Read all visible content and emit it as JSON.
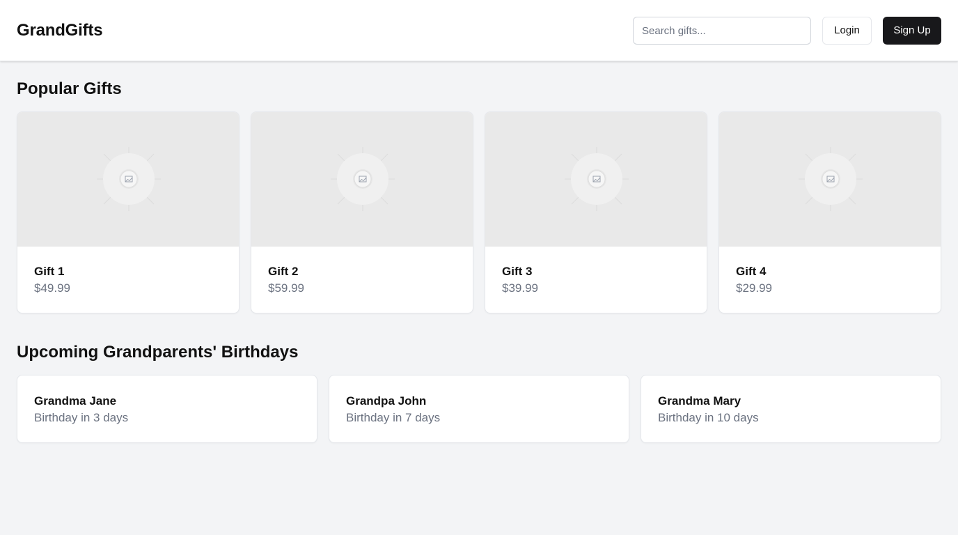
{
  "header": {
    "brand": "GrandGifts",
    "search_placeholder": "Search gifts...",
    "login_label": "Login",
    "signup_label": "Sign Up"
  },
  "popular": {
    "title": "Popular Gifts",
    "items": [
      {
        "name": "Gift 1",
        "price": "$49.99"
      },
      {
        "name": "Gift 2",
        "price": "$59.99"
      },
      {
        "name": "Gift 3",
        "price": "$39.99"
      },
      {
        "name": "Gift 4",
        "price": "$29.99"
      }
    ]
  },
  "birthdays": {
    "title": "Upcoming Grandparents' Birthdays",
    "items": [
      {
        "name": "Grandma Jane",
        "when": "Birthday in 3 days"
      },
      {
        "name": "Grandpa John",
        "when": "Birthday in 7 days"
      },
      {
        "name": "Grandma Mary",
        "when": "Birthday in 10 days"
      }
    ]
  },
  "icons": {
    "image_placeholder": "image-placeholder-icon"
  },
  "colors": {
    "background": "#f3f4f6",
    "primary_button": "#18181b",
    "muted_text": "#6b7280"
  }
}
